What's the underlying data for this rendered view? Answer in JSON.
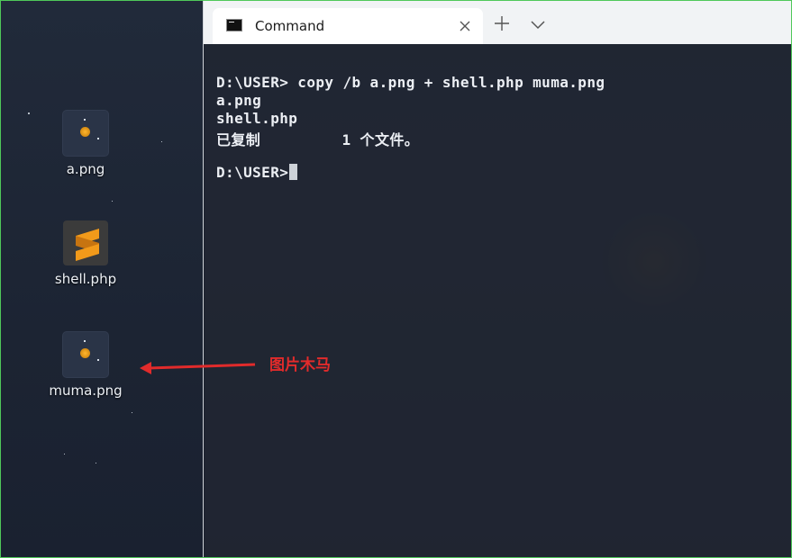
{
  "desktop": {
    "icons": [
      {
        "label": "a.png",
        "icon": "png-image-icon"
      },
      {
        "label": "shell.php",
        "icon": "sublime-text-icon"
      },
      {
        "label": "muma.png",
        "icon": "png-image-icon"
      }
    ]
  },
  "terminal": {
    "tab_title": "Command",
    "tab_icon": "command-prompt-icon",
    "close_icon": "close-icon",
    "new_tab_icon": "plus-icon",
    "dropdown_icon": "chevron-down-icon",
    "lines": [
      "D:\\USER> copy /b a.png + shell.php muma.png",
      "a.png",
      "shell.php",
      "已复制         1 个文件。",
      "",
      "D:\\USER>"
    ]
  },
  "annotation": {
    "text": "图片木马",
    "color": "#e12b2b"
  },
  "colors": {
    "frame_border": "#4fc85a",
    "sublime_orange": "#f29a1a"
  }
}
